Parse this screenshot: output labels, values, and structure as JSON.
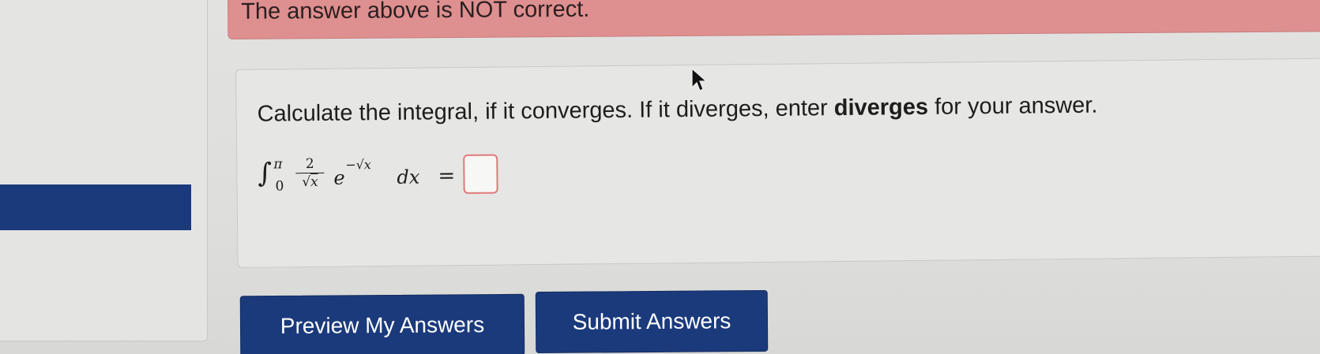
{
  "alert": {
    "message": "The answer above is NOT correct."
  },
  "problem": {
    "prompt_before": "Calculate the integral, if it converges. If it diverges, enter ",
    "prompt_bold": "diverges",
    "prompt_after": " for your answer.",
    "integral_symbol": "∫",
    "upper_limit": "π",
    "lower_limit": "0",
    "numerator": "2",
    "denominator_root": "√",
    "denominator_var": "x",
    "exp_base": "e",
    "exponent": "−√x",
    "differential": "dx",
    "equals": "=",
    "answer_value": ""
  },
  "buttons": {
    "preview_label": "Preview My Answers",
    "submit_label": "Submit Answers"
  },
  "colors": {
    "alert_bg": "#de8f8f",
    "button_bg": "#1b3a7c",
    "input_border": "#e07a7a"
  }
}
